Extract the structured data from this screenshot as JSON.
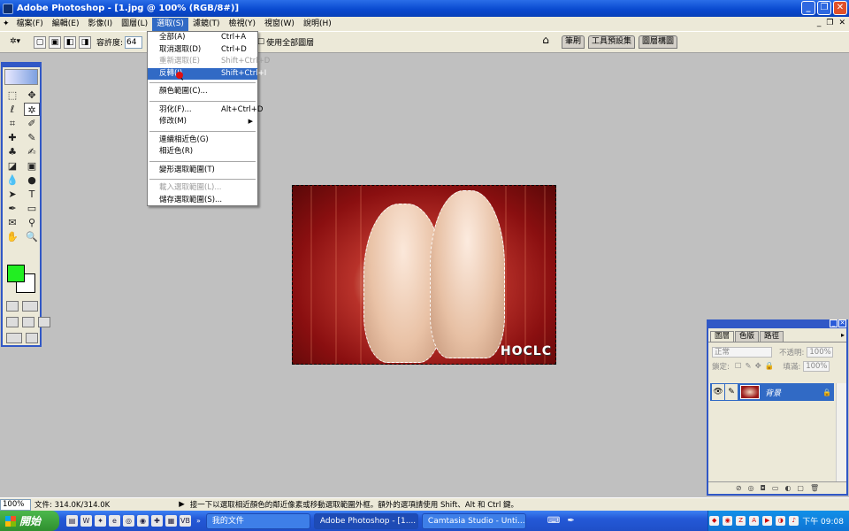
{
  "window": {
    "title": "Adobe Photoshop - [1.jpg @ 100% (RGB/8#)]",
    "buttons": {
      "minimize": "_",
      "restore": "❐",
      "close": "✕"
    }
  },
  "menubar": {
    "items": [
      "檔案(F)",
      "編輯(E)",
      "影像(I)",
      "圖層(L)",
      "選取(S)",
      "濾鏡(T)",
      "檢視(Y)",
      "視窗(W)",
      "說明(H)"
    ],
    "active_index": 4,
    "doc_controls": [
      "_",
      "❐",
      "✕"
    ]
  },
  "options": {
    "tolerance_label": "容許度:",
    "tolerance_value": "64",
    "use_all_layers": "使用全部圖層"
  },
  "palette_well": {
    "tabs": [
      "筆刷",
      "工具預設集",
      "圖層構圖"
    ]
  },
  "select_menu": {
    "items": [
      {
        "label": "全部(A)",
        "shortcut": "Ctrl+A",
        "state": "normal"
      },
      {
        "label": "取消選取(D)",
        "shortcut": "Ctrl+D",
        "state": "normal"
      },
      {
        "label": "重新選取(E)",
        "shortcut": "Shift+Ctrl+D",
        "state": "disabled"
      },
      {
        "label": "反轉(I)",
        "shortcut": "Shift+Ctrl+I",
        "state": "highlighted"
      },
      {
        "sep": true
      },
      {
        "label": "顏色範圍(C)...",
        "shortcut": "",
        "state": "normal"
      },
      {
        "sep": true
      },
      {
        "label": "羽化(F)...",
        "shortcut": "Alt+Ctrl+D",
        "state": "normal"
      },
      {
        "label": "修改(M)",
        "shortcut": "",
        "state": "submenu"
      },
      {
        "sep": true
      },
      {
        "label": "連續相近色(G)",
        "shortcut": "",
        "state": "normal"
      },
      {
        "label": "相近色(R)",
        "shortcut": "",
        "state": "normal"
      },
      {
        "sep": true
      },
      {
        "label": "變形選取範圍(T)",
        "shortcut": "",
        "state": "normal"
      },
      {
        "sep": true
      },
      {
        "label": "載入選取範圍(L)...",
        "shortcut": "",
        "state": "disabled"
      },
      {
        "label": "儲存選取範圍(S)...",
        "shortcut": "",
        "state": "normal"
      }
    ]
  },
  "toolbox": {
    "tools": [
      {
        "icon": "⬚",
        "name": "marquee-icon"
      },
      {
        "icon": "✥",
        "name": "move-icon"
      },
      {
        "icon": "ℓ",
        "name": "lasso-icon"
      },
      {
        "icon": "✲",
        "name": "magic-wand-icon"
      },
      {
        "icon": "⌗",
        "name": "crop-icon"
      },
      {
        "icon": "✐",
        "name": "slice-icon"
      },
      {
        "icon": "✚",
        "name": "healing-brush-icon"
      },
      {
        "icon": "✎",
        "name": "brush-icon"
      },
      {
        "icon": "♣",
        "name": "stamp-icon"
      },
      {
        "icon": "✍",
        "name": "history-brush-icon"
      },
      {
        "icon": "◪",
        "name": "eraser-icon"
      },
      {
        "icon": "▣",
        "name": "gradient-icon"
      },
      {
        "icon": "💧",
        "name": "blur-icon"
      },
      {
        "icon": "●",
        "name": "dodge-icon"
      },
      {
        "icon": "➤",
        "name": "path-select-icon"
      },
      {
        "icon": "T",
        "name": "type-icon"
      },
      {
        "icon": "✒",
        "name": "pen-icon"
      },
      {
        "icon": "▭",
        "name": "shape-icon"
      },
      {
        "icon": "✉",
        "name": "notes-icon"
      },
      {
        "icon": "⚲",
        "name": "eyedropper-icon"
      },
      {
        "icon": "✋",
        "name": "hand-icon"
      },
      {
        "icon": "🔍",
        "name": "zoom-icon"
      }
    ],
    "selected_index": 3,
    "foreground_color": "#22ee22",
    "background_color": "#ffffff"
  },
  "image": {
    "watermark": "HOCLC"
  },
  "layers_panel": {
    "tabs": [
      "圖層",
      "色版",
      "路徑"
    ],
    "blend_mode": "正常",
    "opacity_label": "不透明:",
    "opacity_value": "100%",
    "lock_label": "鎖定:",
    "fill_label": "填滿:",
    "fill_value": "100%",
    "layer_name": "背景"
  },
  "status": {
    "zoom": "100%",
    "doc": "文件: 314.0K/314.0K",
    "hint": "接一下以選取相近顏色的鄰近像素或移動選取範圍外框。額外的選項請使用 Shift、Alt 和 Ctrl 鍵。"
  },
  "taskbar": {
    "start": "開始",
    "tasks": [
      {
        "label": "我的文件",
        "active": false
      },
      {
        "label": "Adobe Photoshop - [1....",
        "active": true
      },
      {
        "label": "Camtasia Studio - Unti...",
        "active": false
      }
    ],
    "clock": "下午 09:08"
  }
}
